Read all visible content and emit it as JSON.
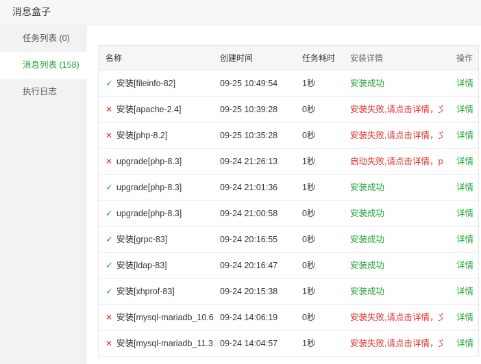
{
  "window": {
    "title": "消息盒子"
  },
  "sidebar": {
    "items": [
      {
        "label": "任务列表 (0)",
        "active": false
      },
      {
        "label": "消息列表 (158)",
        "active": true
      },
      {
        "label": "执行日志",
        "active": false
      }
    ]
  },
  "table": {
    "headers": {
      "name": "名称",
      "time": "创建时间",
      "duration": "任务耗时",
      "detail": "安装详情",
      "op": "操作"
    },
    "rows": [
      {
        "status": "success",
        "status_icon": "check-icon",
        "name": "安装[fileinfo-82]",
        "time": "09-25 10:49:54",
        "duration": "1秒",
        "detail": "安装成功",
        "op": "详情"
      },
      {
        "status": "fail",
        "status_icon": "cross-icon",
        "name": "安装[apache-2.4]",
        "time": "09-25 10:39:28",
        "duration": "0秒",
        "detail": "安装失败,请点击详情，文",
        "op": "详情"
      },
      {
        "status": "fail",
        "status_icon": "cross-icon",
        "name": "安装[php-8.2]",
        "time": "09-25 10:35:28",
        "duration": "0秒",
        "detail": "安装失败,请点击详情，文",
        "op": "详情"
      },
      {
        "status": "fail",
        "status_icon": "cross-icon",
        "name": "upgrade[php-8.3]",
        "time": "09-24 21:26:13",
        "duration": "1秒",
        "detail": "启动失败,请点击详情，pi",
        "op": "详情"
      },
      {
        "status": "success",
        "status_icon": "check-icon",
        "name": "upgrade[php-8.3]",
        "time": "09-24 21:01:36",
        "duration": "1秒",
        "detail": "安装成功",
        "op": "详情"
      },
      {
        "status": "success",
        "status_icon": "check-icon",
        "name": "upgrade[php-8.3]",
        "time": "09-24 21:00:58",
        "duration": "0秒",
        "detail": "安装成功",
        "op": "详情"
      },
      {
        "status": "success",
        "status_icon": "check-icon",
        "name": "安装[grpc-83]",
        "time": "09-24 20:16:55",
        "duration": "0秒",
        "detail": "安装成功",
        "op": "详情"
      },
      {
        "status": "success",
        "status_icon": "check-icon",
        "name": "安装[ldap-83]",
        "time": "09-24 20:16:47",
        "duration": "0秒",
        "detail": "安装成功",
        "op": "详情"
      },
      {
        "status": "success",
        "status_icon": "check-icon",
        "name": "安装[xhprof-83]",
        "time": "09-24 20:15:38",
        "duration": "1秒",
        "detail": "安装成功",
        "op": "详情"
      },
      {
        "status": "fail",
        "status_icon": "cross-icon",
        "name": "安装[mysql-mariadb_10.6",
        "time": "09-24 14:06:19",
        "duration": "0秒",
        "detail": "安装失败,请点击详情，文",
        "op": "详情"
      },
      {
        "status": "fail",
        "status_icon": "cross-icon",
        "name": "安装[mysql-mariadb_11.3",
        "time": "09-24 14:04:57",
        "duration": "1秒",
        "detail": "安装失败,请点击详情，文",
        "op": "详情"
      }
    ]
  },
  "colors": {
    "success": "#20a53a",
    "fail": "#e0302c",
    "accent": "#20a53a"
  }
}
